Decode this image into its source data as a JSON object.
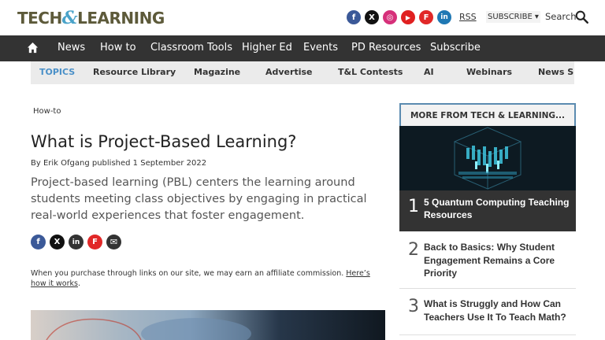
{
  "header": {
    "logo_left": "TECH",
    "logo_amp": "&",
    "logo_right": "LEARNING",
    "social": [
      {
        "icon": "facebook-icon",
        "glyph": "f",
        "color": "#3b5998"
      },
      {
        "icon": "x-icon",
        "glyph": "X",
        "color": "#111111"
      },
      {
        "icon": "instagram-icon",
        "glyph": "◎",
        "color": "#d6307a"
      },
      {
        "icon": "youtube-icon",
        "glyph": "▶",
        "color": "#e02020"
      },
      {
        "icon": "flipboard-icon",
        "glyph": "F",
        "color": "#e12828"
      },
      {
        "icon": "linkedin-icon",
        "glyph": "in",
        "color": "#1f78b4"
      }
    ],
    "rss": "RSS",
    "subscribe": "SUBSCRIBE ▾",
    "search": "Search"
  },
  "nav": {
    "items": [
      "News",
      "How to",
      "Classroom Tools",
      "Higher Ed",
      "Events",
      "PD Resources",
      "Subscribe"
    ]
  },
  "topics": {
    "items": [
      "TOPICS",
      "Resource Library",
      "Magazine",
      "Advertise",
      "T&L Contests",
      "AI",
      "Webinars",
      "News Sig"
    ]
  },
  "article": {
    "breadcrumb": "How-to",
    "title": "What is Project-Based Learning?",
    "byline": "By Erik Ofgang published 1 September 2022",
    "lede": "Project-based learning (PBL) centers the learning around students meeting class objectives by engaging in practical real-world experiences that foster engagement.",
    "share": [
      {
        "icon": "facebook-share-icon",
        "glyph": "f",
        "color": "#3b5998"
      },
      {
        "icon": "x-share-icon",
        "glyph": "X",
        "color": "#111111"
      },
      {
        "icon": "linkedin-share-icon",
        "glyph": "in",
        "color": "#333333"
      },
      {
        "icon": "flipboard-share-icon",
        "glyph": "F",
        "color": "#e12828"
      },
      {
        "icon": "email-share-icon",
        "glyph": "✉",
        "color": "#333333"
      }
    ],
    "affiliate_text": "When you purchase through links on our site, we may earn an affiliate commission. ",
    "affiliate_link": "Here’s how it works",
    "affiliate_end": "."
  },
  "sidebar": {
    "heading": "MORE FROM TECH & LEARNING...",
    "featured": {
      "num": "1",
      "title": "5 Quantum Computing Teaching Resources"
    },
    "items": [
      {
        "num": "2",
        "title": "Back to Basics: Why Student Engagement Remains a Core Priority"
      },
      {
        "num": "3",
        "title": "What is Struggly and How Can Teachers Use It To Teach Math?"
      }
    ]
  }
}
